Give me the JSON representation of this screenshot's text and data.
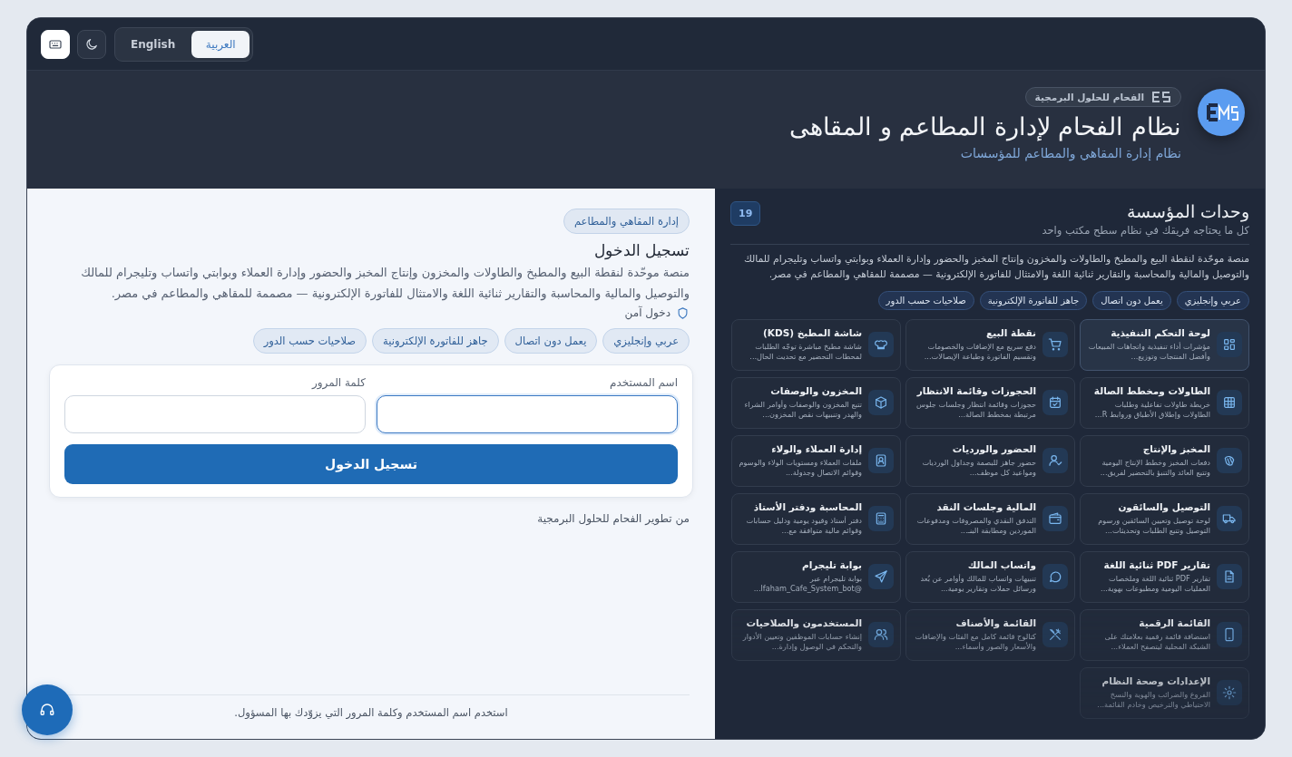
{
  "top_bar": {
    "keyboard_button": {
      "on": true
    },
    "theme_button": {
      "on": false
    },
    "languages": [
      {
        "label": "العربية",
        "selected": true
      },
      {
        "label": "English",
        "selected": false
      }
    ]
  },
  "header": {
    "company_badge": "الفحام للحلول البرمجية",
    "title": "نظام الفحام لإدارة المطاعم و المقاهى",
    "subtitle": "نظام إدارة المقاهي والمطاعم للمؤسسات"
  },
  "login": {
    "pill": "إدارة المقاهي والمطاعم",
    "title": "تسجيل الدخول",
    "description": "منصة موحّدة لنقطة البيع والمطبخ والطاولات والمخزون وإنتاج المخبز والحضور وإدارة العملاء وبوابتي واتساب وتليجرام للمالك والتوصيل والمالية والمحاسبة والتقارير ثنائية اللغة والامتثال للفاتورة الإلكترونية — مصممة للمقاهي والمطاعم في مصر.",
    "secure_note": "دخول آمن",
    "tags": [
      "عربي وإنجليزي",
      "يعمل دون اتصال",
      "جاهز للفاتورة الإلكترونية",
      "صلاحيات حسب الدور"
    ],
    "fields": [
      {
        "label": "اسم المستخدم",
        "focused": true
      },
      {
        "label": "كلمة المرور",
        "focused": false
      }
    ],
    "submit": "تسجيل الدخول",
    "credit": "من تطوير الفحام للحلول البرمجية",
    "hint": "استخدم اسم المستخدم وكلمة المرور التي يزوّدك بها المسؤول."
  },
  "modules": {
    "title": "وحدات المؤسسة",
    "count": "19",
    "subtitle": "كل ما يحتاجه فريقك في نظام سطح مكتب واحد",
    "description": "منصة موحّدة لنقطة البيع والمطبخ والطاولات والمخزون وإنتاج المخبز والحضور وإدارة العملاء وبوابتي واتساب وتليجرام للمالك والتوصيل والمالية والمحاسبة والتقارير ثنائية اللغة والامتثال للفاتورة الإلكترونية — مصممة للمقاهي والمطاعم في مصر.",
    "tags": [
      "عربي وإنجليزي",
      "يعمل دون اتصال",
      "جاهز للفاتورة الإلكترونية",
      "صلاحيات حسب الدور"
    ],
    "cards": [
      {
        "title": "لوحة التحكم التنفيذية",
        "text": "مؤشرات أداء تنفيذية واتجاهات المبيعات وأفضل المنتجات وتوزيع...",
        "selected": true
      },
      {
        "title": "نقطة البيع",
        "text": "دفع سريع مع الإضافات والخصومات وتقسيم الفاتورة وطباعة الإيصالات...",
        "selected": false
      },
      {
        "title": "شاشة المطبخ (KDS)",
        "text": "شاشة مطبخ مباشرة توجّه الطلبات لمحطات التحضير مع تحديث الحال...",
        "selected": false
      },
      {
        "title": "الطاولات ومخطط الصالة",
        "text": "خريطة طاولات تفاعلية وطلبات الطاولات وإطلاق الأطباق وروابط R...",
        "selected": false
      },
      {
        "title": "الحجوزات وقائمة الانتظار",
        "text": "حجوزات وقائمة انتظار وجلسات جلوس مرتبطة بمخطط الصالة...",
        "selected": false
      },
      {
        "title": "المخزون والوصفات",
        "text": "تتبع المخزون والوصفات وأوامر الشراء والهدر وتنبيهات نقص المخزون...",
        "selected": false
      },
      {
        "title": "المخبز والإنتاج",
        "text": "دفعات المخبز وخطط الإنتاج اليومية وتتبع العائد والتنبؤ بالتحضير لفريق...",
        "selected": false
      },
      {
        "title": "الحضور والورديات",
        "text": "حضور جاهز للبصمة وجداول الورديات ومواعيد كل موظف...",
        "selected": false
      },
      {
        "title": "إدارة العملاء والولاء",
        "text": "ملفات العملاء ومستويات الولاء والوسوم وقوائم الاتصال وجدولة...",
        "selected": false
      },
      {
        "title": "التوصيل والسائقون",
        "text": "لوحة توصيل وتعيين السائقين ورسوم التوصيل وتتبع الطلبات وتحديثات...",
        "selected": false
      },
      {
        "title": "المالية وجلسات النقد",
        "text": "التدفق النقدي والمصروفات ومدفوعات الموردين ومطابقة البنـ...",
        "selected": false
      },
      {
        "title": "المحاسبة ودفتر الأستاذ",
        "text": "دفتر أستاذ وقيود يومية ودليل حسابات وقوائم مالية متوافقة مع...",
        "selected": false
      },
      {
        "title": "تقارير PDF ثنائية اللغة",
        "text": "تقارير PDF ثنائية اللغة وملخصات العمليات اليومية ومطبوعات بهوية...",
        "selected": false
      },
      {
        "title": "واتساب المالك",
        "text": "تنبيهات واتساب للمالك وأوامر عن بُعد ورسائل حملات وتقارير يومية...",
        "selected": false
      },
      {
        "title": "بوابة تليجرام",
        "text": "بوابة تليجرام عبر @lfaham_Cafe_System_bot...",
        "selected": false
      },
      {
        "title": "القائمة الرقمية",
        "text": "استضافة قائمة رقمية بعلامتك على الشبكة المحلية ليتصفح العملاء...",
        "selected": false
      },
      {
        "title": "القائمة والأصناف",
        "text": "كتالوج قائمة كامل مع الفئات والإضافات والأسعار والصور وأسماء...",
        "selected": false
      },
      {
        "title": "المستخدمون والصلاحيات",
        "text": "إنشاء حسابات الموظفين وتعيين الأدوار والتحكم في الوصول وإدارة...",
        "selected": false
      },
      {
        "title": "الإعدادات وصحة النظام",
        "text": "الفروع والضرائب والهوية والنسخ الاحتياطي والترخيص وخادم القائمة...",
        "selected": false
      }
    ]
  }
}
